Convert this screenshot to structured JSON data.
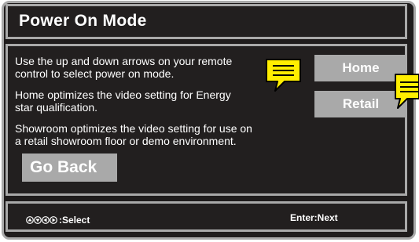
{
  "title": "Power On Mode",
  "description": {
    "line1": "Use the up and down arrows on your remote",
    "line2": "control to select power on mode.",
    "line3": "Home optimizes the video setting for Energy",
    "line4": "star qualification.",
    "line5": "Showroom optimizes the video setting for use on",
    "line6": "a retail showroom floor or demo environment."
  },
  "buttons": {
    "home": "Home",
    "retail": "Retail",
    "go_back": "Go Back"
  },
  "footer": {
    "select_label": ":Select",
    "enter_label": "Enter:Next",
    "select_icons": [
      "up-arrow-icon",
      "down-arrow-icon",
      "left-arrow-icon",
      "right-arrow-icon"
    ]
  },
  "colors": {
    "background": "#1f1c1c",
    "border": "#a9a9a9",
    "button": "#a9a9a9",
    "text": "#ffffff",
    "note_yellow": "#ffee00"
  }
}
